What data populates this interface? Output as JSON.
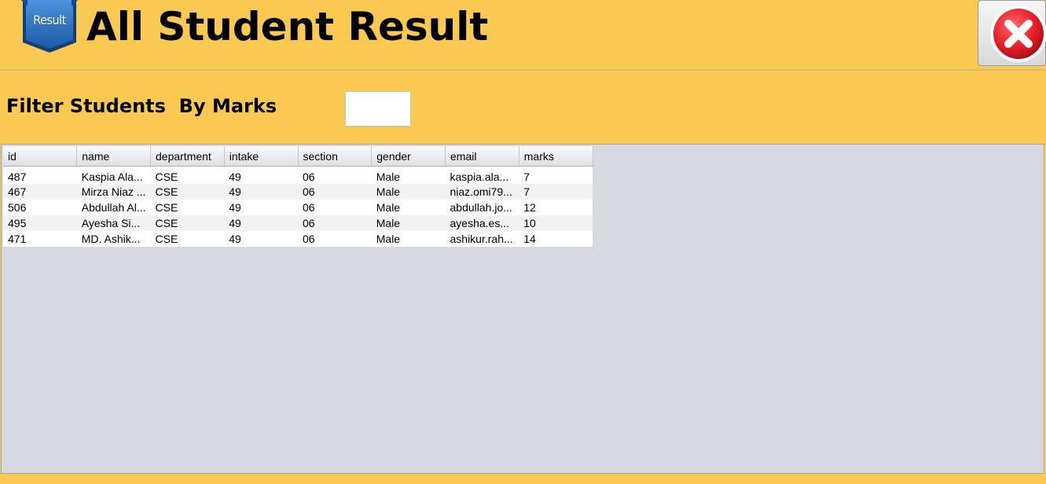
{
  "header": {
    "logo_text": "Result",
    "title": "All Student Result",
    "close_icon": "close-icon"
  },
  "filter": {
    "label": "Filter Students  By Marks",
    "value": "",
    "placeholder": ""
  },
  "table": {
    "columns": [
      "id",
      "name",
      "department",
      "intake",
      "section",
      "gender",
      "email",
      "marks"
    ],
    "rows": [
      [
        "487",
        "Kaspia Ala...",
        "CSE",
        "49",
        "06",
        "Male",
        "kaspia.ala...",
        "7"
      ],
      [
        "467",
        "Mirza Niaz ...",
        "CSE",
        "49",
        "06",
        "Male",
        "niaz.omi79...",
        "7"
      ],
      [
        "506",
        "Abdullah Al...",
        "CSE",
        "49",
        "06",
        "Male",
        "abdullah.jo...",
        "12"
      ],
      [
        "495",
        "Ayesha Si...",
        "CSE",
        "49",
        "06",
        "Male",
        "ayesha.es...",
        "10"
      ],
      [
        "471",
        "MD. Ashik...",
        "CSE",
        "49",
        "06",
        "Male",
        "ashikur.rah...",
        "14"
      ]
    ]
  },
  "colors": {
    "background": "#f9c951",
    "close_red": "#e8202a",
    "logo_blue": "#2f78c8"
  }
}
